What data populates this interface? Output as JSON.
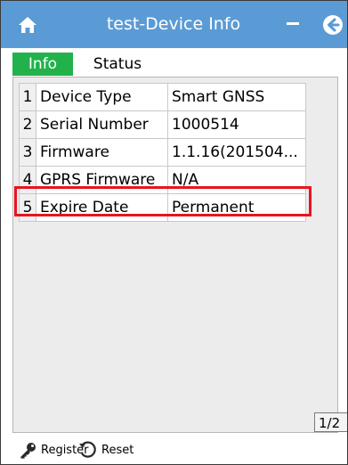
{
  "window": {
    "title": "test-Device Info"
  },
  "tabs": [
    {
      "label": "Info",
      "active": true
    },
    {
      "label": "Status",
      "active": false
    }
  ],
  "table": {
    "rows": [
      {
        "index": "1",
        "key": "Device Type",
        "value": "Smart GNSS"
      },
      {
        "index": "2",
        "key": "Serial Number",
        "value": "1000514"
      },
      {
        "index": "3",
        "key": "Firmware",
        "value": "1.1.16(201504..."
      },
      {
        "index": "4",
        "key": "GPRS Firmware",
        "value": "N/A"
      },
      {
        "index": "5",
        "key": "Expire Date",
        "value": "Permanent",
        "highlighted": true
      }
    ]
  },
  "pager": {
    "label": "1/2"
  },
  "toolbar": {
    "register_label": "Register",
    "reset_label": "Reset"
  },
  "icons": {
    "home": "home-icon",
    "minimize": "minimize-icon",
    "back": "back-arrow-icon",
    "register": "key-icon",
    "reset": "reset-icon"
  },
  "colors": {
    "titlebar": "#5b9bd5",
    "active_tab": "#22b24c",
    "highlight": "#e8141e"
  }
}
